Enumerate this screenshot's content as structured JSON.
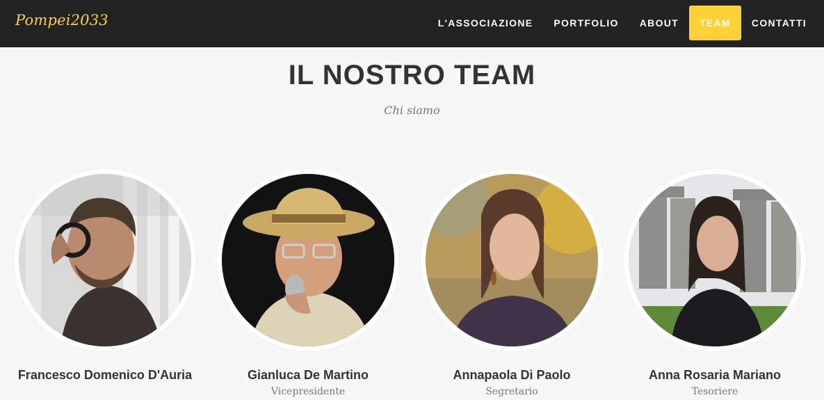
{
  "nav": {
    "brand": "Pompei2033",
    "links": [
      {
        "label": "L'ASSOCIAZIONE",
        "active": false
      },
      {
        "label": "PORTFOLIO",
        "active": false
      },
      {
        "label": "ABOUT",
        "active": false
      },
      {
        "label": "TEAM",
        "active": true
      },
      {
        "label": "CONTATTI",
        "active": false
      }
    ]
  },
  "team": {
    "heading": "IL NOSTRO TEAM",
    "subheading": "Chi siamo",
    "members": [
      {
        "name": "Francesco Domenico D'Auria",
        "role": ""
      },
      {
        "name": "Gianluca De Martino",
        "role": "Vicepresidente"
      },
      {
        "name": "Annapaola Di Paolo",
        "role": "Segretario"
      },
      {
        "name": "Anna Rosaria Mariano",
        "role": "Tesoriere"
      }
    ]
  },
  "colors": {
    "navbar_bg": "#222222",
    "accent": "#fed136",
    "page_bg": "#f7f7f7",
    "heading_text": "#333333",
    "muted_text": "#777777"
  }
}
